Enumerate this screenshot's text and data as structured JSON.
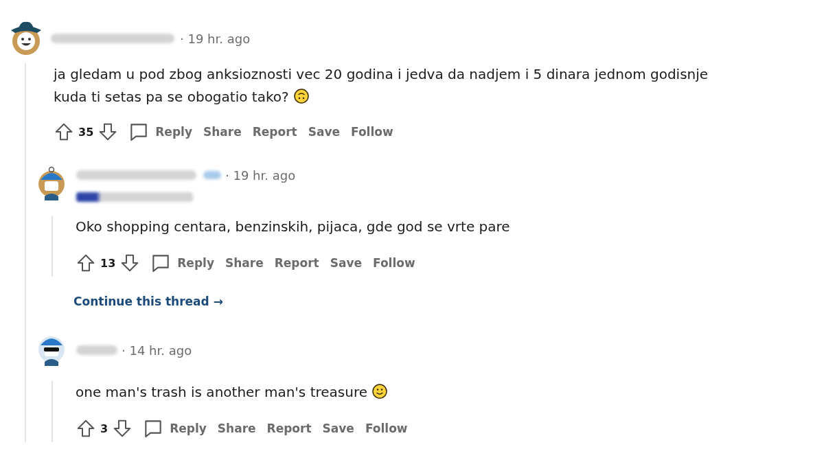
{
  "comments": [
    {
      "avatar": {
        "kind": "hat"
      },
      "time": "· 19 hr. ago",
      "lines": [
        "ja gledam u pod zbog anksioznosti vec 20 godina i jedva da nadjem i 5 dinara jednom godisnje",
        "kuda ti setas pa se obogatio tako?"
      ],
      "emoji": {
        "kind": "upside-down"
      },
      "score": "35",
      "actions": [
        "Reply",
        "Share",
        "Report",
        "Save",
        "Follow"
      ],
      "children": [
        {
          "avatar": {
            "kind": "sailor"
          },
          "time": "· 19 hr. ago",
          "op": true,
          "flair": true,
          "lines": [
            "Oko shopping centara, benzinskih, pijaca, gde god se vrte pare"
          ],
          "score": "13",
          "actions": [
            "Reply",
            "Share",
            "Report",
            "Save",
            "Follow"
          ],
          "continue": "Continue this thread →"
        },
        {
          "avatar": {
            "kind": "shades"
          },
          "time": "· 14 hr. ago",
          "op": false,
          "flair": false,
          "lines": [
            "one man's trash is another man's treasure"
          ],
          "emoji": {
            "kind": "smile"
          },
          "score": "3",
          "actions": [
            "Reply",
            "Share",
            "Report",
            "Save",
            "Follow"
          ]
        }
      ]
    }
  ]
}
